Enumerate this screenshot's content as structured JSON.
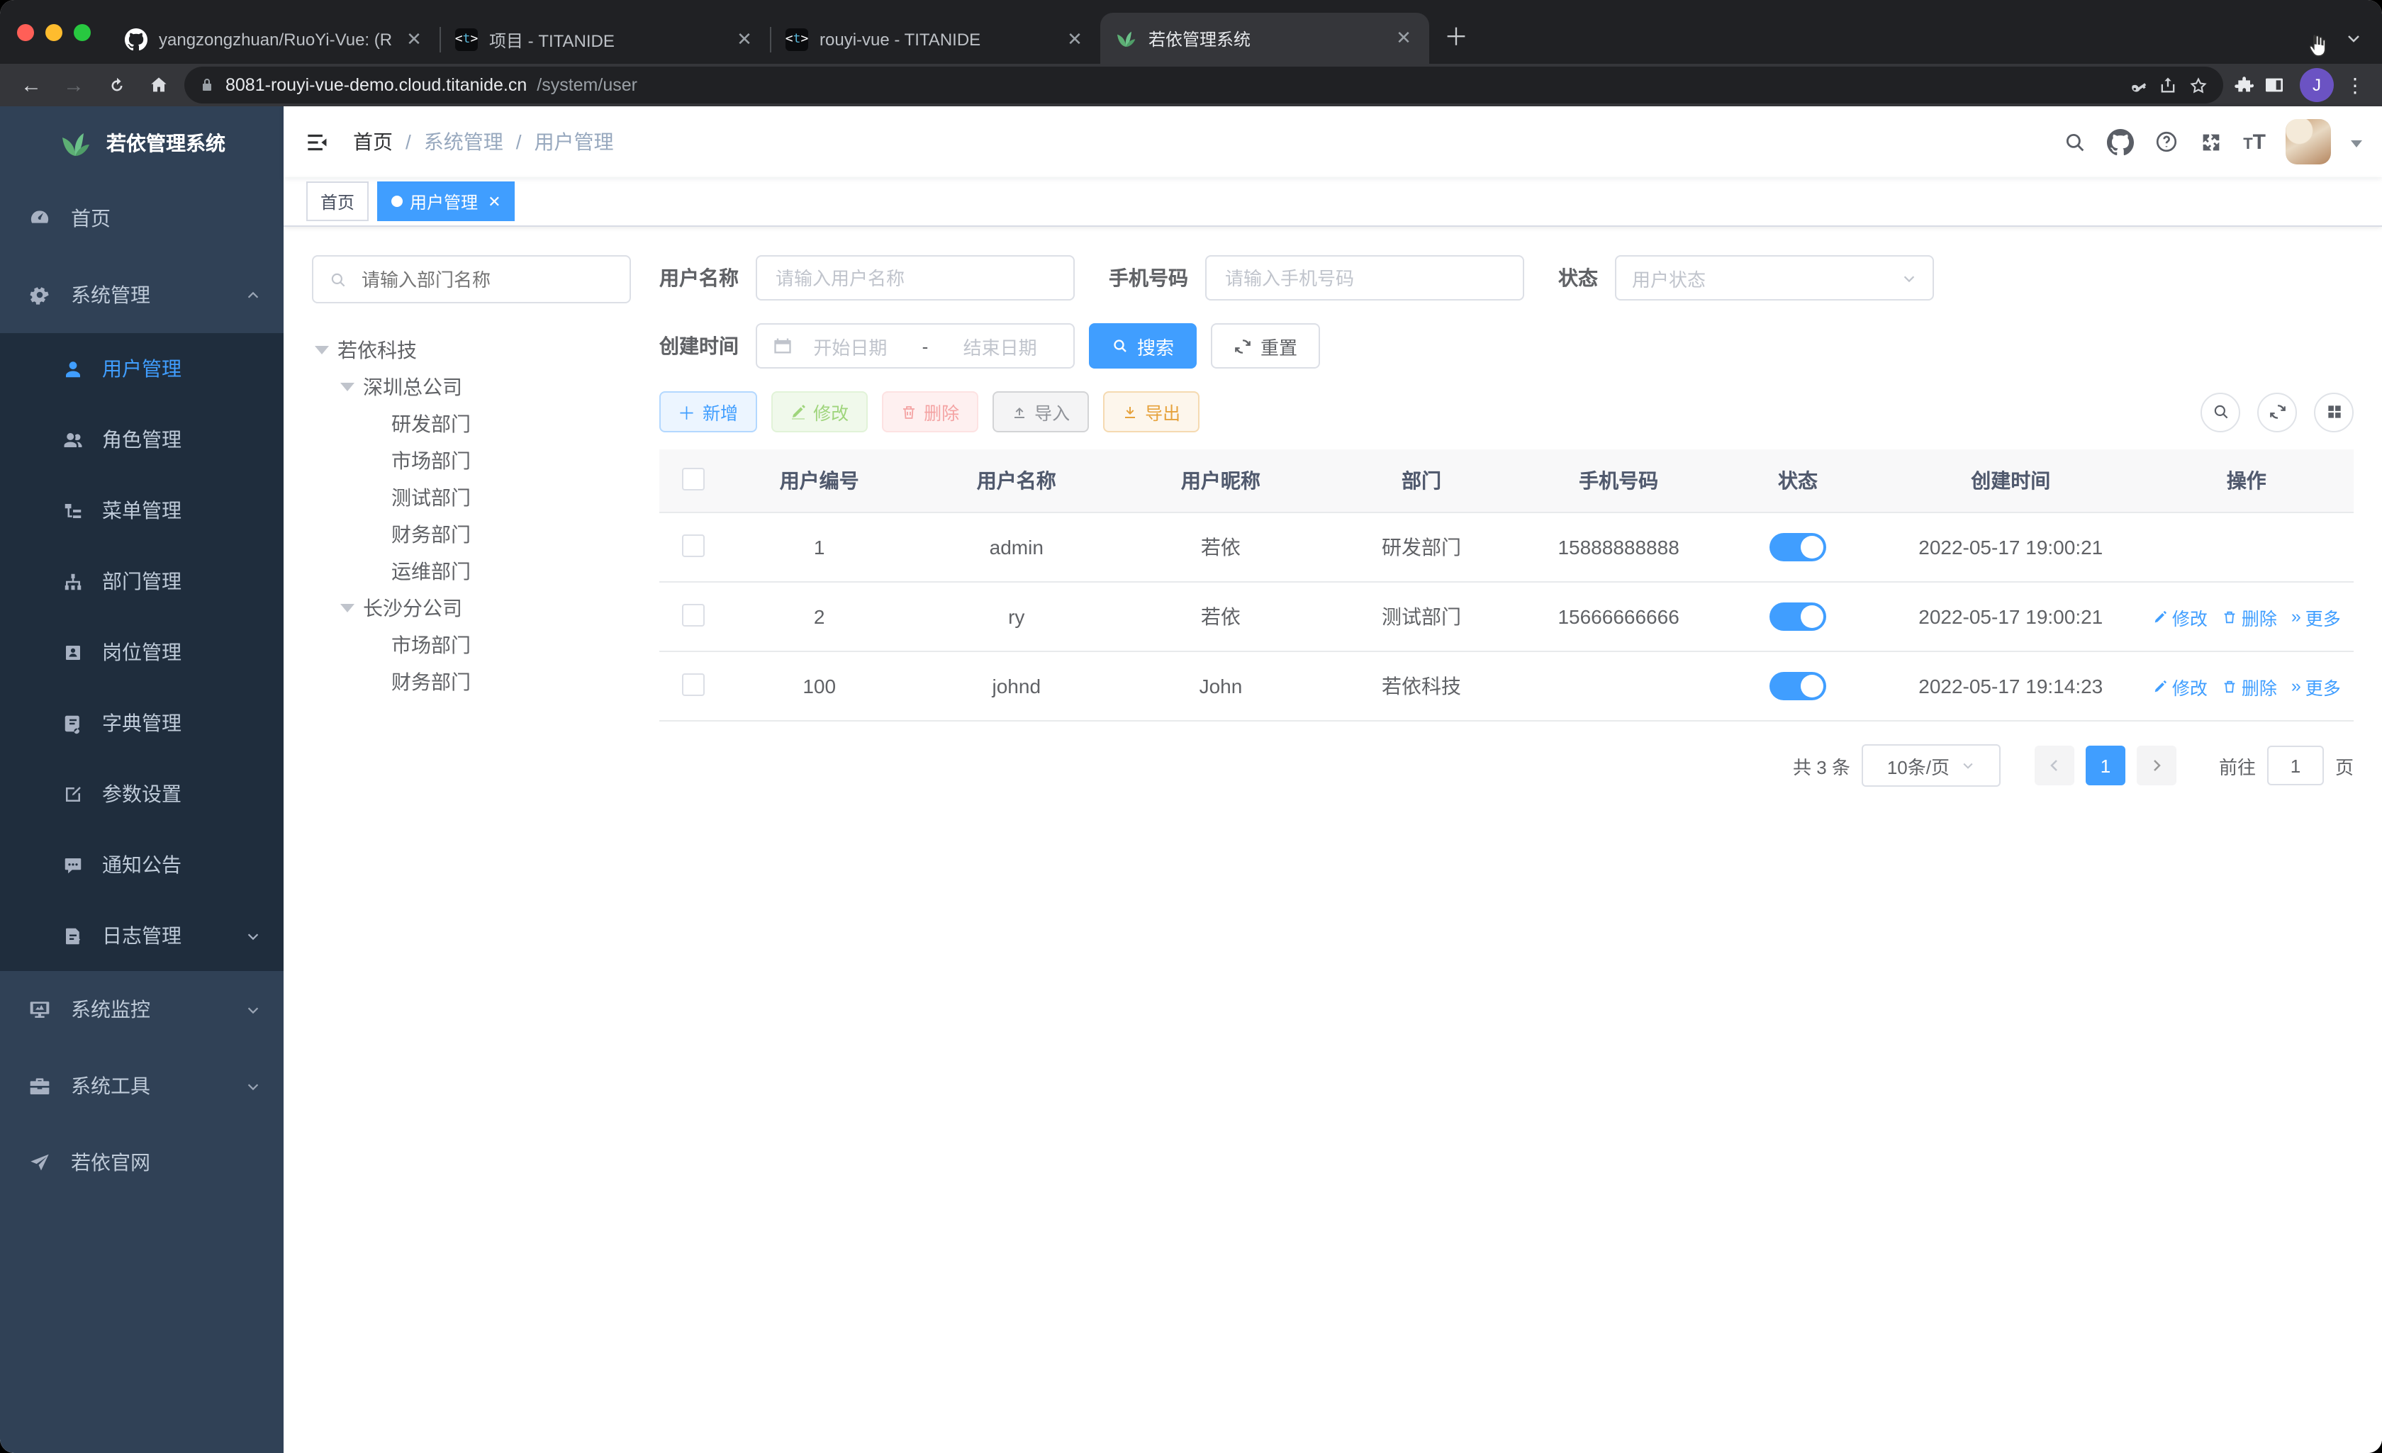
{
  "browser": {
    "tabs": [
      {
        "title": "yangzongzhuan/RuoYi-Vue: (R"
      },
      {
        "title": "项目 - TITANIDE"
      },
      {
        "title": "rouyi-vue - TITANIDE"
      },
      {
        "title": "若依管理系统"
      }
    ],
    "url": {
      "host": "8081-rouyi-vue-demo.cloud.titanide.cn",
      "path": "/system/user"
    },
    "profile_initial": "J"
  },
  "sidebar": {
    "logo_title": "若依管理系统",
    "menu": [
      {
        "label": "首页"
      },
      {
        "label": "系统管理"
      },
      {
        "label": "用户管理"
      },
      {
        "label": "角色管理"
      },
      {
        "label": "菜单管理"
      },
      {
        "label": "部门管理"
      },
      {
        "label": "岗位管理"
      },
      {
        "label": "字典管理"
      },
      {
        "label": "参数设置"
      },
      {
        "label": "通知公告"
      },
      {
        "label": "日志管理"
      },
      {
        "label": "系统监控"
      },
      {
        "label": "系统工具"
      },
      {
        "label": "若依官网"
      }
    ]
  },
  "navbar": {
    "breadcrumb": {
      "home": "首页",
      "section": "系统管理",
      "page": "用户管理"
    }
  },
  "tags": {
    "home": "首页",
    "current": "用户管理"
  },
  "dept_tree": {
    "search_placeholder": "请输入部门名称",
    "nodes": [
      "若依科技",
      "深圳总公司",
      "研发部门",
      "市场部门",
      "测试部门",
      "财务部门",
      "运维部门",
      "长沙分公司",
      "市场部门",
      "财务部门"
    ]
  },
  "filters": {
    "username_label": "用户名称",
    "username_placeholder": "请输入用户名称",
    "phone_label": "手机号码",
    "phone_placeholder": "请输入手机号码",
    "status_label": "状态",
    "status_placeholder": "用户状态",
    "created_label": "创建时间",
    "date_start_placeholder": "开始日期",
    "date_separator": "-",
    "date_end_placeholder": "结束日期",
    "search_label": "搜索",
    "reset_label": "重置"
  },
  "toolbar": {
    "add": "新增",
    "edit": "修改",
    "delete": "删除",
    "import": "导入",
    "export": "导出"
  },
  "table": {
    "columns": [
      "用户编号",
      "用户名称",
      "用户昵称",
      "部门",
      "手机号码",
      "状态",
      "创建时间",
      "操作"
    ],
    "action_labels": {
      "edit": "修改",
      "delete": "删除",
      "more": "更多"
    },
    "rows": [
      {
        "id": "1",
        "username": "admin",
        "nickname": "若依",
        "dept": "研发部门",
        "phone": "15888888888",
        "status_on": true,
        "created": "2022-05-17 19:00:21",
        "has_actions": false
      },
      {
        "id": "2",
        "username": "ry",
        "nickname": "若依",
        "dept": "测试部门",
        "phone": "15666666666",
        "status_on": true,
        "created": "2022-05-17 19:00:21",
        "has_actions": true
      },
      {
        "id": "100",
        "username": "johnd",
        "nickname": "John",
        "dept": "若依科技",
        "phone": "",
        "status_on": true,
        "created": "2022-05-17 19:14:23",
        "has_actions": true
      }
    ]
  },
  "pagination": {
    "total_text": "共 3 条",
    "page_size": "10条/页",
    "current_page": "1",
    "goto_label": "前往",
    "goto_value": "1",
    "page_suffix": "页"
  },
  "colors": {
    "accent": "#409eff",
    "sidebar_bg": "#304156",
    "submenu_bg": "#1f2d3d",
    "tag_active": "#409eff",
    "switch_on": "#409eff"
  }
}
